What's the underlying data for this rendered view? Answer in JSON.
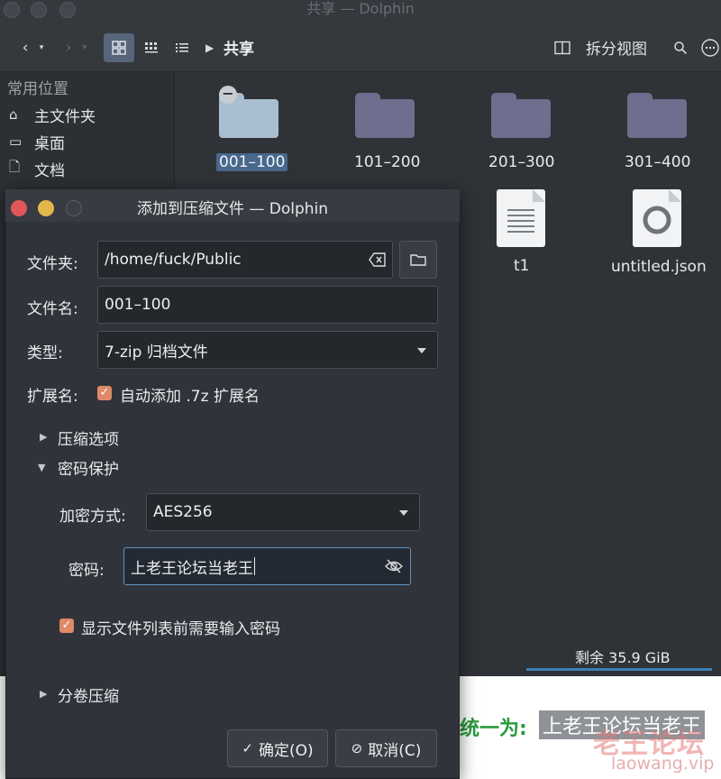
{
  "window": {
    "title": "共享 — Dolphin"
  },
  "toolbar": {
    "breadcrumb": "共享",
    "split_view_label": "拆分视图"
  },
  "sidebar": {
    "heading": "常用位置",
    "items": [
      {
        "label": "主文件夹",
        "icon": "home-icon"
      },
      {
        "label": "桌面",
        "icon": "desktop-icon"
      },
      {
        "label": "文档",
        "icon": "document-icon"
      }
    ]
  },
  "files": [
    {
      "name": "001–100",
      "type": "folder",
      "selected": true
    },
    {
      "name": "101–200",
      "type": "folder"
    },
    {
      "name": "201–300",
      "type": "folder"
    },
    {
      "name": "301–400",
      "type": "folder"
    },
    {
      "name": "t1",
      "type": "text-file"
    },
    {
      "name": "untitled.json",
      "type": "json-file"
    }
  ],
  "statusbar": {
    "free_space": "剩余 35.9 GiB"
  },
  "dialog": {
    "title": "添加到压缩文件 — Dolphin",
    "folder_label": "文件夹:",
    "folder_value": "/home/fuck/Public",
    "filename_label": "文件名:",
    "filename_value": "001–100",
    "type_label": "类型:",
    "type_value": "7-zip 归档文件",
    "extension_label": "扩展名:",
    "extension_checkbox": "自动添加 .7z 扩展名",
    "compression_section": "压缩选项",
    "password_section": "密码保护",
    "encryption_label": "加密方式:",
    "encryption_value": "AES256",
    "password_label": "密码:",
    "password_value": "上老王论坛当老王",
    "encrypt_list_checkbox": "显示文件列表前需要输入密码",
    "split_section": "分卷压缩",
    "ok_label": "确定(O)",
    "cancel_label": "取消(C)"
  },
  "background_page": {
    "caption": "统一为:",
    "highlight": "上老王论坛当老王",
    "watermark_title": "老王论坛",
    "watermark_url": "laowang.vip"
  },
  "colors": {
    "accent": "#5f94c4",
    "selection": "#48688c",
    "checkbox": "#e08968",
    "folder": "#6f6e8e",
    "caption_green": "#2a9a3c"
  }
}
